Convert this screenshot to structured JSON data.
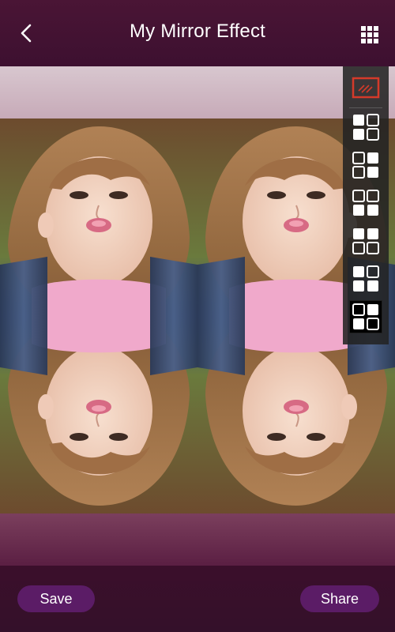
{
  "app": {
    "title": "My Mirror Effect"
  },
  "actions": {
    "save_label": "Save",
    "share_label": "Share"
  },
  "effects_tray": {
    "selected_index": 6,
    "items": [
      {
        "icon": "mirror-frame-icon"
      },
      {
        "icon": "grid-2x2-tl-icon"
      },
      {
        "icon": "grid-2x2-tr-bl-icon"
      },
      {
        "icon": "grid-2x2-bottom-icon"
      },
      {
        "icon": "grid-2x2-top-icon"
      },
      {
        "icon": "grid-2x2-left-icon"
      },
      {
        "icon": "grid-2x2-right-icon"
      }
    ]
  },
  "colors": {
    "topbar": "#4a1535",
    "button": "#5b1c66",
    "accent_red": "#d43a2a"
  }
}
